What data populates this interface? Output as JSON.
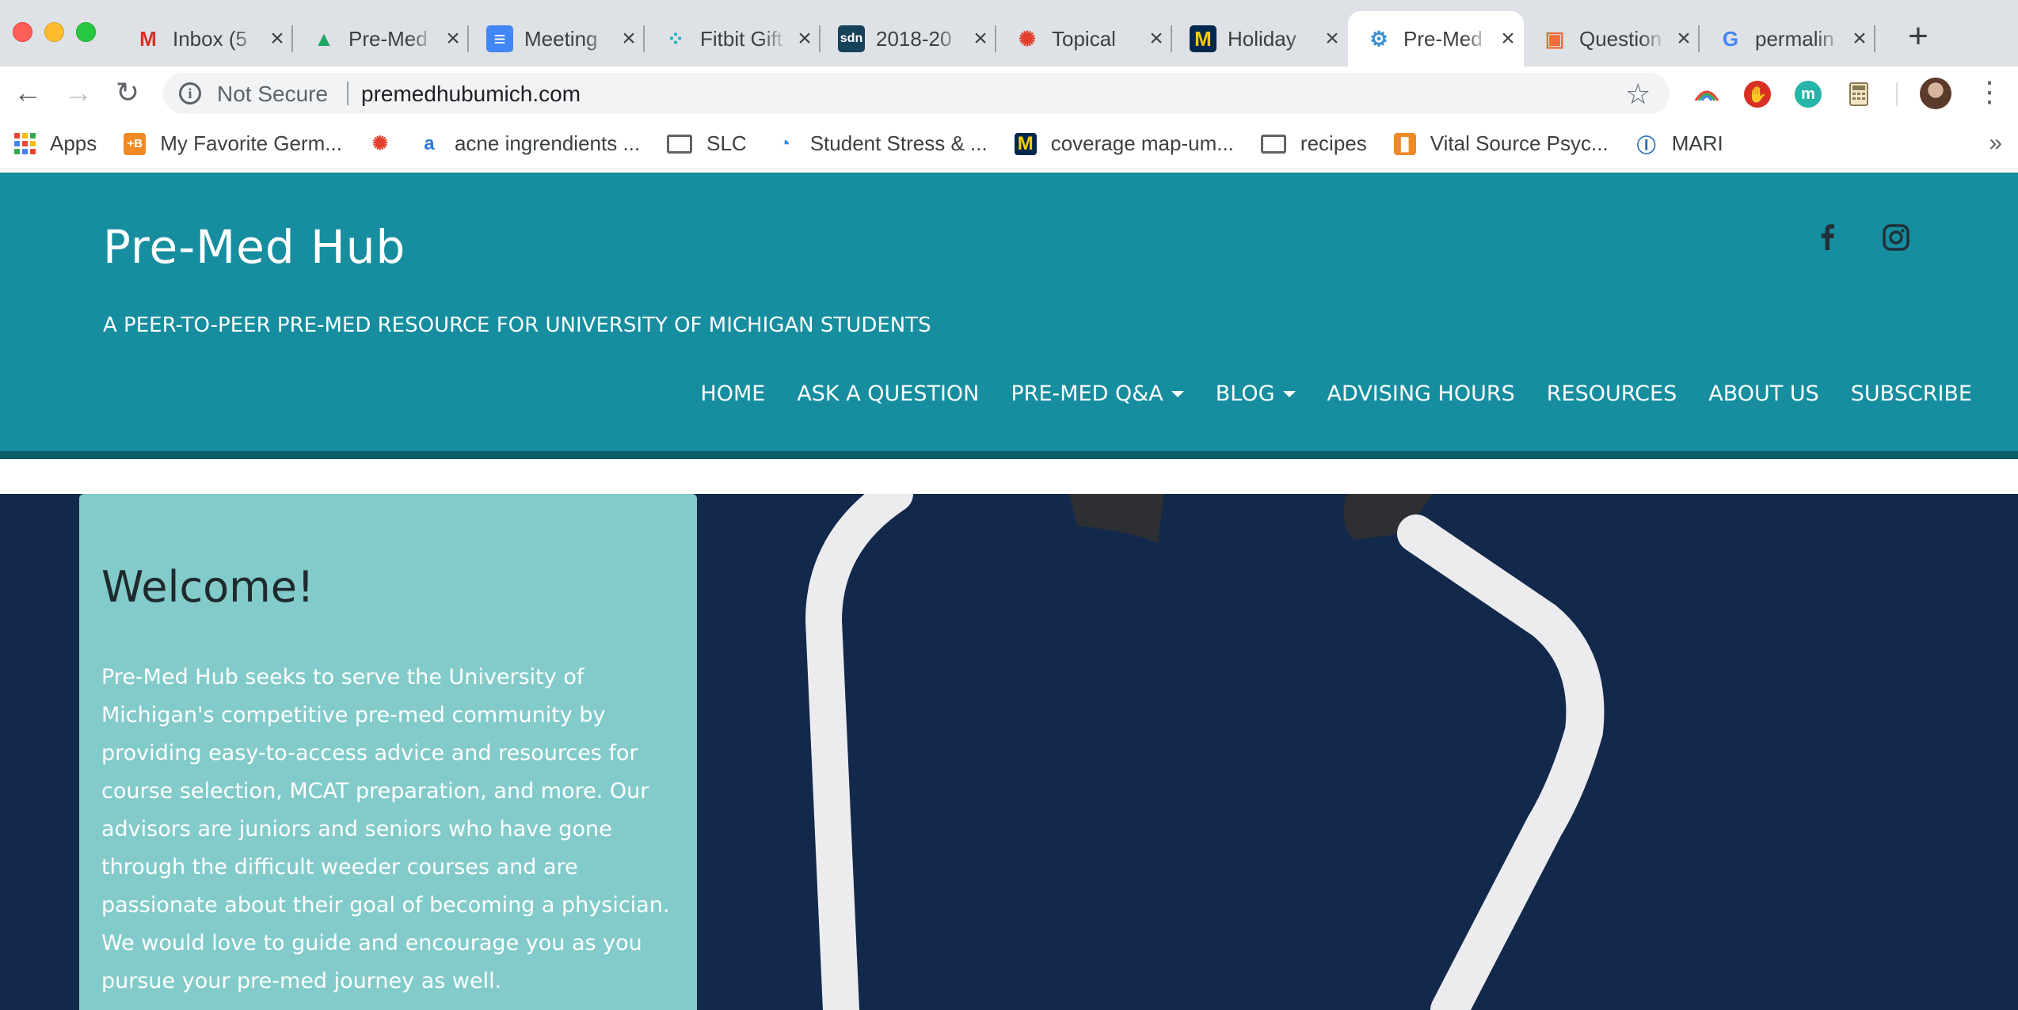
{
  "browser": {
    "tabs": [
      {
        "title": "Inbox (5",
        "favicon": "gmail-icon",
        "color": "#d93025",
        "glyph": "M",
        "active": false
      },
      {
        "title": "Pre-Med",
        "favicon": "google-drive-icon",
        "color": "#1fa463",
        "glyph": "▲",
        "active": false
      },
      {
        "title": "Meeting",
        "favicon": "google-docs-icon",
        "color": "#4285f4",
        "glyph": "≡",
        "active": false
      },
      {
        "title": "Fitbit Gift",
        "favicon": "fitbit-icon",
        "color": "#00b0b9",
        "glyph": "⁘",
        "active": false
      },
      {
        "title": "2018-20",
        "favicon": "sdn-icon",
        "color": "#17435a",
        "glyph": "sdn",
        "active": false
      },
      {
        "title": "Topical",
        "favicon": "canvas-icon",
        "color": "#e13f2b",
        "glyph": "✺",
        "active": false
      },
      {
        "title": "Holiday",
        "favicon": "umich-icon",
        "color": "#00274c",
        "glyph": "M",
        "active": false
      },
      {
        "title": "Pre-Med",
        "favicon": "premedhub-icon",
        "color": "#3b8fd6",
        "glyph": "⚙",
        "active": true
      },
      {
        "title": "Question",
        "favicon": "forms-icon",
        "color": "#ef6c3c",
        "glyph": "▣",
        "active": false
      },
      {
        "title": "permalin",
        "favicon": "google-icon",
        "color": "#4285f4",
        "glyph": "G",
        "active": false
      }
    ],
    "new_tab": "+",
    "back": "←",
    "forward": "→",
    "reload": "↻",
    "security_label": "Not Secure",
    "url": "premedhubumich.com",
    "bookmark_star": "☆",
    "menu": "⋮",
    "bookmarks": [
      {
        "label": "Apps",
        "icon": "apps-grid-icon"
      },
      {
        "label": "My Favorite Germ...",
        "icon": "plus-b-icon",
        "color": "#f08a24",
        "glyph": "+B"
      },
      {
        "label": "",
        "icon": "canvas-icon",
        "color": "#e13f2b",
        "glyph": "✺"
      },
      {
        "label": "acne ingrendients ...",
        "icon": "amazon-icon",
        "color": "#2a7bd8",
        "glyph": "a"
      },
      {
        "label": "SLC",
        "icon": "folder-icon"
      },
      {
        "label": "Student Stress & ...",
        "icon": "brain-icon",
        "color": "#2a8ad8",
        "glyph": "◔"
      },
      {
        "label": "coverage map-um...",
        "icon": "umich-icon",
        "color": "#00274c",
        "glyph": "M"
      },
      {
        "label": "recipes",
        "icon": "folder-icon"
      },
      {
        "label": "Vital Source Psyc...",
        "icon": "bookmark-icon",
        "color": "#f08a24",
        "glyph": "▮"
      },
      {
        "label": "MARI",
        "icon": "mari-icon",
        "color": "#2a6fb5",
        "glyph": "Ⓘ"
      }
    ],
    "bookmarks_more": "»"
  },
  "site": {
    "title": "Pre-Med Hub",
    "tagline": "A PEER-TO-PEER PRE-MED RESOURCE FOR UNIVERSITY OF MICHIGAN STUDENTS",
    "nav": [
      {
        "label": "HOME",
        "dropdown": false
      },
      {
        "label": "ASK A QUESTION",
        "dropdown": false
      },
      {
        "label": "PRE-MED Q&A",
        "dropdown": true
      },
      {
        "label": "BLOG",
        "dropdown": true
      },
      {
        "label": "ADVISING HOURS",
        "dropdown": false
      },
      {
        "label": "RESOURCES",
        "dropdown": false
      },
      {
        "label": "ABOUT US",
        "dropdown": false
      },
      {
        "label": "SUBSCRIBE",
        "dropdown": false
      }
    ],
    "colors": {
      "header": "#168e9f",
      "hero": "#13294b",
      "card": "#82cbca"
    }
  },
  "welcome": {
    "title": "Welcome!",
    "body": "Pre-Med Hub seeks to serve the University of Michigan's competitive pre-med community by providing easy-to-access advice and resources for course selection, MCAT preparation, and more. Our advisors are juniors and seniors who have gone through the difficult weeder courses and are passionate about their goal of becoming a physician. We would love to guide and encourage you as you pursue your pre-med journey as well."
  }
}
